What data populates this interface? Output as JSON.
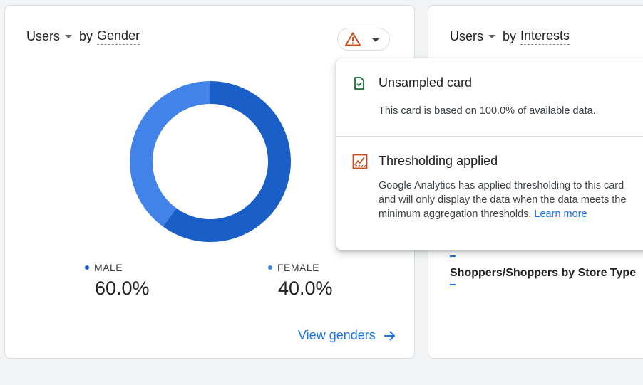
{
  "gender_card": {
    "metric": "Users",
    "by": "by",
    "dimension": "Gender",
    "legend": [
      {
        "label": "MALE",
        "value": "60.0%"
      },
      {
        "label": "FEMALE",
        "value": "40.0%"
      }
    ],
    "view_link": "View genders",
    "colors": {
      "male": "#1a5ec8",
      "female": "#4283ea"
    }
  },
  "chart_data": {
    "type": "pie",
    "variant": "donut",
    "categories": [
      "MALE",
      "FEMALE"
    ],
    "values": [
      60.0,
      40.0
    ],
    "title": ""
  },
  "interests_card": {
    "metric": "Users",
    "by": "by",
    "dimension": "Interests",
    "row_visible": "Shoppers/Shoppers by Store Type"
  },
  "popup": {
    "unsampled_title": "Unsampled card",
    "unsampled_text": "This card is based on 100.0% of available data.",
    "threshold_title": "Thresholding applied",
    "threshold_text": "Google Analytics has applied thresholding to this card and will only display the data when the data meets the minimum aggregation thresholds.",
    "learn_more": "Learn more"
  },
  "icons": {
    "warning": "warning-icon",
    "unsampled": "check-document-icon",
    "threshold": "threshold-chart-icon",
    "arrow": "arrow-right-icon"
  }
}
